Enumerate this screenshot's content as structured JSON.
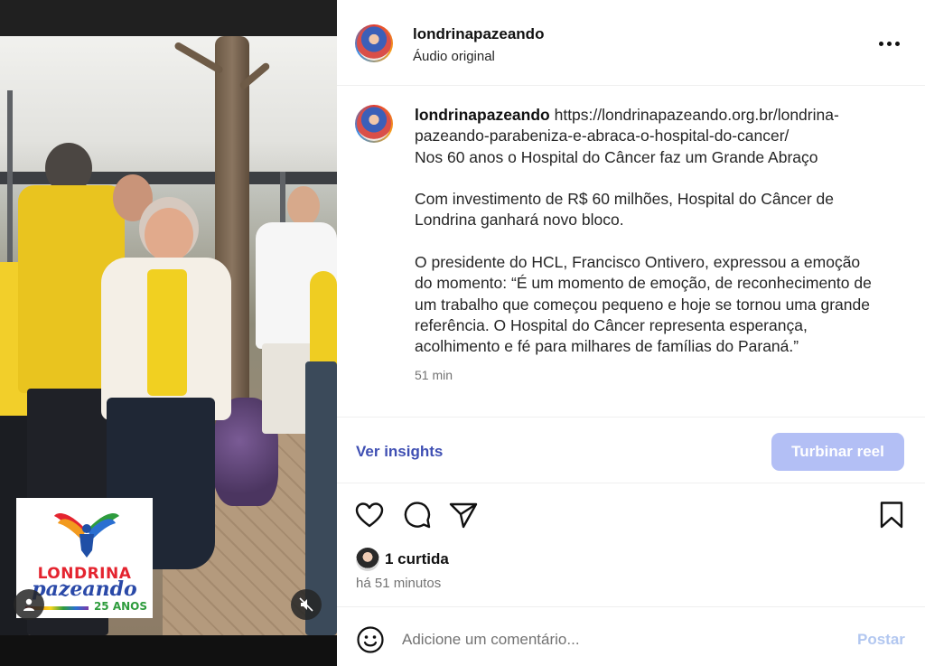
{
  "post": {
    "username": "londrinapazeando",
    "audio_label": "Áudio original",
    "caption": {
      "username": "londrinapazeando",
      "text": " https://londrinapazeando.org.br/londrina-pazeando-parabeniza-e-abraca-o-hospital-do-cancer/\nNos 60 anos o Hospital do Câncer faz um Grande Abraço\n\nCom investimento de R$ 60 milhões, Hospital do Câncer de Londrina ganhará novo bloco.\n\nO presidente do HCL, Francisco Ontivero, expressou a emoção do momento: “É um momento de emoção, de reconhecimento de um trabalho que começou pequeno e hoje se tornou uma grande referência. O Hospital do Câncer representa esperança, acolhimento e fé para milhares de famílias do Paraná.”"
    },
    "caption_time": "51 min",
    "insights_label": "Ver insights",
    "boost_label": "Turbinar reel",
    "likes_label": "1 curtida",
    "posted_ago": "há 51 minutos",
    "comment_placeholder": "Adicione um comentário...",
    "post_label": "Postar"
  },
  "media": {
    "logo": {
      "title": "LONDRINA",
      "script": "pazeando",
      "years": "25 ANOS"
    }
  },
  "icons": {
    "more": "more-options-icon",
    "like": "heart-icon",
    "comment": "comment-icon",
    "share": "send-icon",
    "save": "bookmark-icon",
    "emoji": "emoji-icon",
    "mute": "mute-icon",
    "tagged": "user-tag-icon"
  },
  "colors": {
    "link": "#3f4fb3",
    "boost_disabled": "#b3bff5",
    "post_disabled": "#b2c7f0",
    "muted_text": "#737373"
  }
}
